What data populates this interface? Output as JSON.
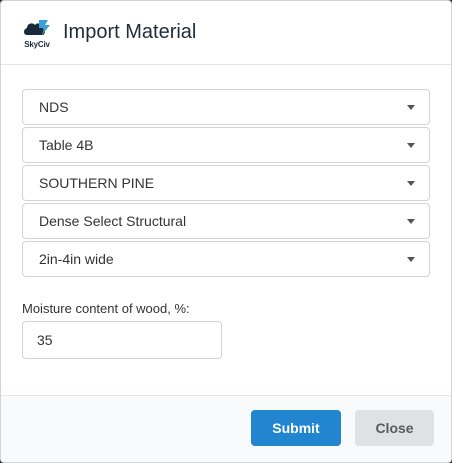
{
  "dialog": {
    "title": "Import Material",
    "logo_text": "SkyCiv"
  },
  "selects": [
    {
      "value": "NDS"
    },
    {
      "value": "Table 4B"
    },
    {
      "value": "SOUTHERN PINE"
    },
    {
      "value": "Dense Select Structural"
    },
    {
      "value": "2in-4in wide"
    }
  ],
  "moisture": {
    "label": "Moisture content of wood, %:",
    "value": "35"
  },
  "footer": {
    "submit_label": "Submit",
    "close_label": "Close"
  },
  "colors": {
    "primary": "#2185d0",
    "secondary": "#e0e1e2",
    "logo_cloud": "#1b2a3a",
    "logo_accent": "#3aa0d8"
  }
}
